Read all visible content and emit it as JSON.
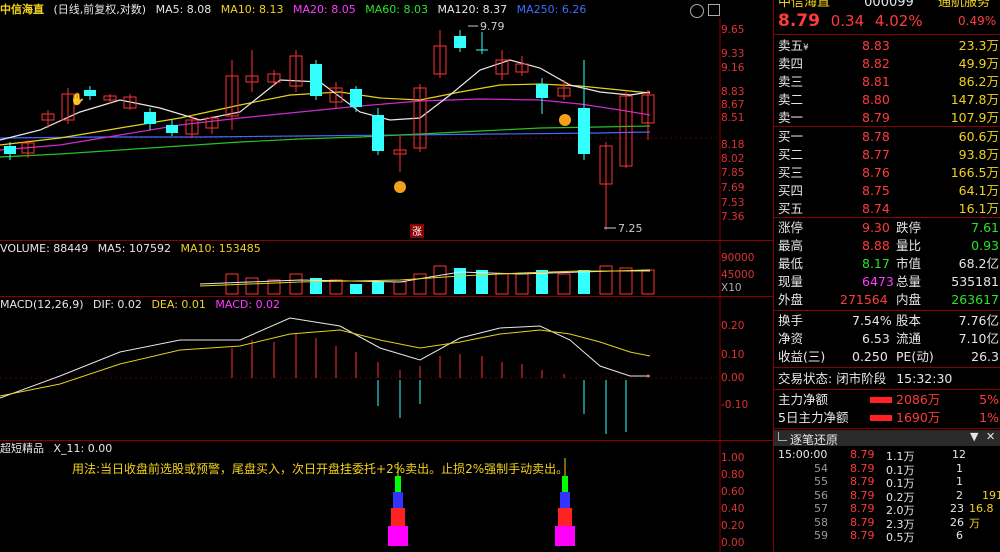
{
  "kline": {
    "stock_name": "中信海直",
    "period_info": "(日线,前复权,对数)",
    "ma5": "MA5: 8.08",
    "ma10": "MA10: 8.13",
    "ma20": "MA20: 8.05",
    "ma60": "MA60: 8.03",
    "ma120": "MA120: 8.37",
    "ma250": "MA250: 6.26",
    "high_mark": "9.79",
    "low_mark": "7.25",
    "limit_up_marker": "涨",
    "price_ticks": [
      "9.65",
      "9.33",
      "9.16",
      "8.83",
      "8.67",
      "8.51",
      "8.18",
      "8.02",
      "7.85",
      "7.69",
      "7.53",
      "7.36"
    ]
  },
  "volume": {
    "label": "VOLUME: 88449",
    "ma5": "MA5: 107592",
    "ma10": "MA10: 153485",
    "ticks": [
      "90000",
      "45000",
      "X10"
    ]
  },
  "macd": {
    "label": "MACD(12,26,9)",
    "dif": "DIF: 0.02",
    "dea": "DEA: 0.01",
    "macd": "MACD: 0.02",
    "ticks": [
      "0.20",
      "0.10",
      "0.00",
      "-0.10"
    ]
  },
  "indicator": {
    "label": "超短精品",
    "x11": "X_11: 0.00",
    "hint": "用法:当日收盘前选股或预警，尾盘买入，次日开盘挂委托+2%卖出。止损2%强制手动卖出。",
    "ticks": [
      "1.00",
      "0.80",
      "0.60",
      "0.40",
      "0.20",
      "0.00"
    ]
  },
  "quote": {
    "name": "中信海直",
    "code": "000099",
    "tag": "通航服务",
    "price": "8.79",
    "change": "0.34",
    "change_pct": "4.02%",
    "weibi": "0.49%",
    "asks": [
      {
        "label": "卖五",
        "price": "8.83",
        "vol": "23.3万"
      },
      {
        "label": "卖四",
        "price": "8.82",
        "vol": "49.9万"
      },
      {
        "label": "卖三",
        "price": "8.81",
        "vol": "86.2万"
      },
      {
        "label": "卖二",
        "price": "8.80",
        "vol": "147.8万"
      },
      {
        "label": "卖一",
        "price": "8.79",
        "vol": "107.9万"
      }
    ],
    "bids": [
      {
        "label": "买一",
        "price": "8.78",
        "vol": "60.6万"
      },
      {
        "label": "买二",
        "price": "8.77",
        "vol": "93.8万"
      },
      {
        "label": "买三",
        "price": "8.76",
        "vol": "166.5万"
      },
      {
        "label": "买四",
        "price": "8.75",
        "vol": "64.1万"
      },
      {
        "label": "买五",
        "price": "8.74",
        "vol": "16.1万"
      }
    ],
    "stats": [
      {
        "k1": "涨停",
        "v1": "9.30",
        "k2": "跌停",
        "v2": "7.61"
      },
      {
        "k1": "最高",
        "v1": "8.88",
        "k2": "量比",
        "v2": "0.93"
      },
      {
        "k1": "最低",
        "v1": "8.17",
        "k2": "市值",
        "v2": "68.2亿"
      },
      {
        "k1": "现量",
        "v1": "6473",
        "k2": "总量",
        "v2": "535181"
      },
      {
        "k1": "外盘",
        "v1": "271564",
        "k2": "内盘",
        "v2": "263617"
      }
    ],
    "fin": [
      {
        "k1": "换手",
        "v1": "7.54%",
        "k2": "股本",
        "v2": "7.76亿"
      },
      {
        "k1": "净资",
        "v1": "6.53",
        "k2": "流通",
        "v2": "7.10亿"
      },
      {
        "k1": "收益(三)",
        "v1": "0.250",
        "k2": "PE(动)",
        "v2": "26.3"
      }
    ],
    "trade_status_label": "交易状态:",
    "trade_status": "闭市阶段",
    "time": "15:32:30",
    "main_net_label": "主力净额",
    "main_net_value": "2086万",
    "main_net_pct": "5%",
    "main_net5_label": "5日主力净额",
    "main_net5_value": "1690万",
    "main_net5_pct": "1%",
    "ticks_title": "逐笔还原",
    "ticks": [
      {
        "t": "15:00:00",
        "p": "8.79",
        "v": "1.1万",
        "n": "12",
        "x": ""
      },
      {
        "t": "54",
        "p": "8.79",
        "v": "0.1万",
        "n": "1",
        "x": ""
      },
      {
        "t": "55",
        "p": "8.79",
        "v": "0.1万",
        "n": "1",
        "x": ""
      },
      {
        "t": "56",
        "p": "8.79",
        "v": "0.2万",
        "n": "2",
        "x": "191"
      },
      {
        "t": "57",
        "p": "8.79",
        "v": "2.0万",
        "n": "23",
        "x": "16.8万"
      },
      {
        "t": "58",
        "p": "8.79",
        "v": "2.3万",
        "n": "26",
        "x": ""
      },
      {
        "t": "59",
        "p": "8.79",
        "v": "0.5万",
        "n": "6",
        "x": ""
      }
    ]
  }
}
